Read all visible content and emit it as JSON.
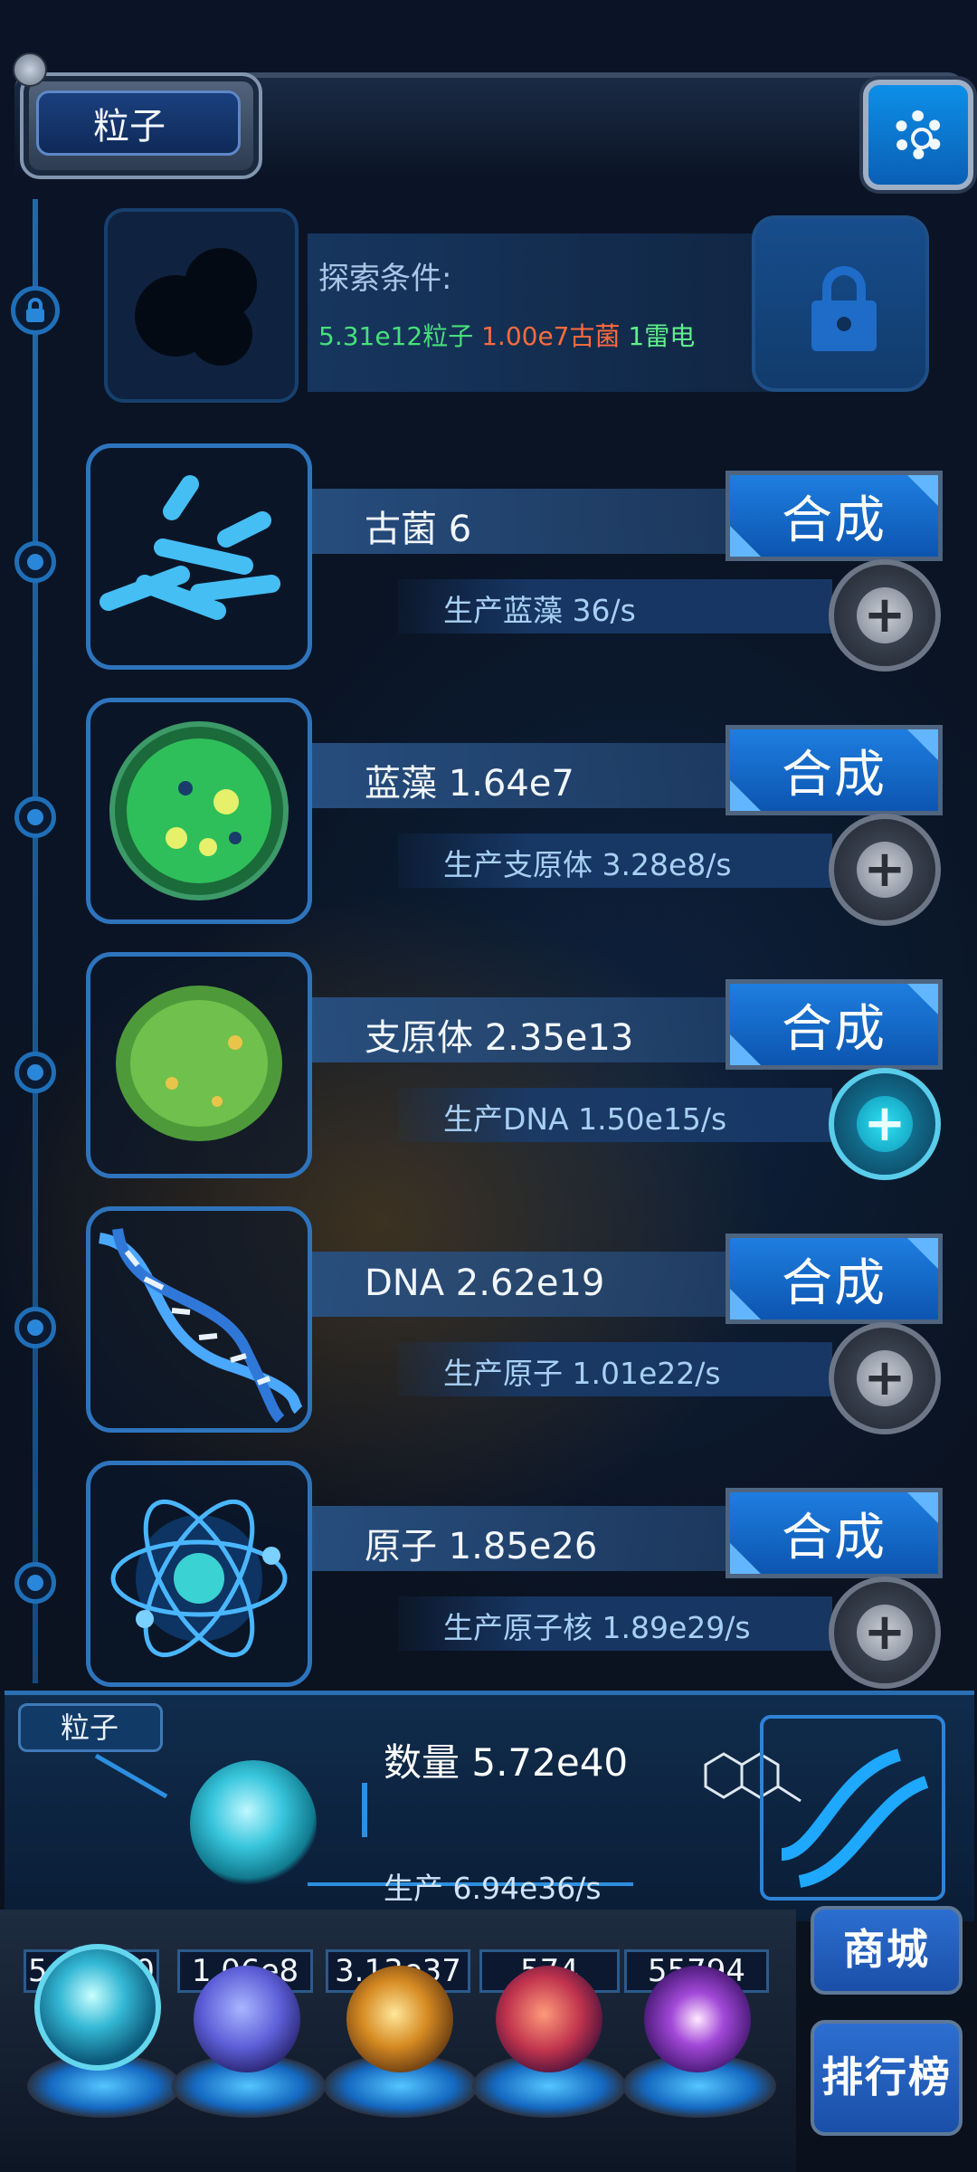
{
  "header": {
    "title": "粒子"
  },
  "explore": {
    "label": "探索条件:",
    "req_1": "5.31e12粒子",
    "req_2": "1.00e7古菌",
    "req_3": "1雷电"
  },
  "items": [
    {
      "name": "古菌 6",
      "production": "生产蓝藻 36/s",
      "synth_label": "合成",
      "icon": "archaea-icon",
      "plus_active": false
    },
    {
      "name": "蓝藻 1.64e7",
      "production": "生产支原体 3.28e8/s",
      "synth_label": "合成",
      "icon": "cyanobacteria-icon",
      "plus_active": false
    },
    {
      "name": "支原体 2.35e13",
      "production": "生产DNA 1.50e15/s",
      "synth_label": "合成",
      "icon": "mycoplasma-icon",
      "plus_active": true
    },
    {
      "name": "DNA 2.62e19",
      "production": "生产原子 1.01e22/s",
      "synth_label": "合成",
      "icon": "dna-icon",
      "plus_active": false
    },
    {
      "name": "原子 1.85e26",
      "production": "生产原子核 1.89e29/s",
      "synth_label": "合成",
      "icon": "atom-icon",
      "plus_active": false
    }
  ],
  "panel": {
    "tab": "粒子",
    "quantity": "数量 5.72e40",
    "production": "生产 6.94e36/s"
  },
  "resources": [
    {
      "value": "5.72e40",
      "icon": "particle-orb-icon"
    },
    {
      "value": "1.06e8",
      "icon": "lightning-orb-icon"
    },
    {
      "value": "3.13e37",
      "icon": "fire-orb-icon"
    },
    {
      "value": "574",
      "icon": "brain-orb-icon"
    },
    {
      "value": "55794",
      "icon": "vortex-orb-icon"
    }
  ],
  "side_buttons": {
    "shop": "商城",
    "ranking": "排行榜"
  },
  "colors": {
    "accent": "#1e7ee0",
    "req_green": "#46e07a",
    "req_orange": "#ff6a3d"
  }
}
